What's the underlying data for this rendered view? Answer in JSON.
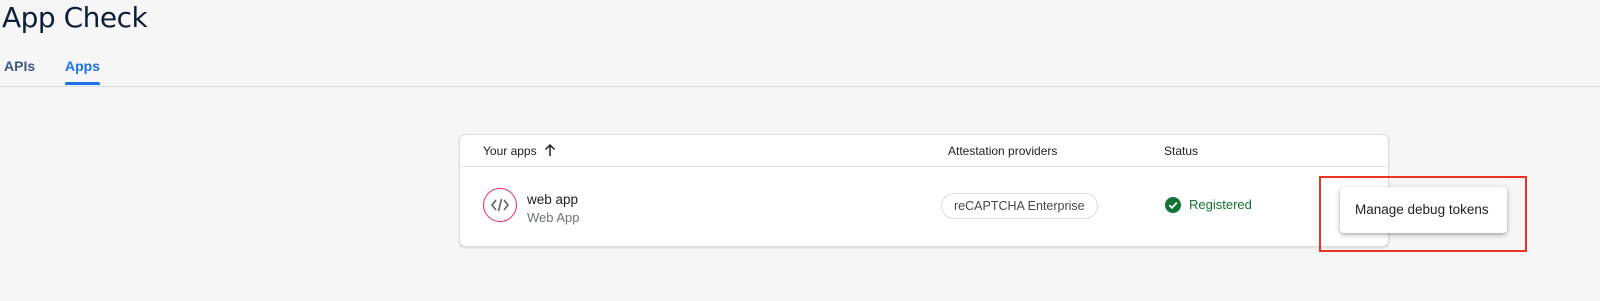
{
  "page": {
    "title": "App Check"
  },
  "tabs": [
    {
      "label": "APIs",
      "active": false
    },
    {
      "label": "Apps",
      "active": true
    }
  ],
  "table": {
    "columns": {
      "apps": "Your apps",
      "attestation": "Attestation providers",
      "status": "Status"
    },
    "sort_icon": "arrow-up-icon",
    "rows": [
      {
        "icon": "code-icon",
        "name": "web app",
        "platform": "Web App",
        "provider": "reCAPTCHA Enterprise",
        "status": "Registered",
        "status_icon": "check-circle-icon"
      }
    ]
  },
  "menu": {
    "items": [
      {
        "label": "Manage debug tokens"
      }
    ]
  },
  "colors": {
    "accent": "#1a73e8",
    "success": "#137333",
    "app_icon": "#e52d5e",
    "highlight": "#ea3323"
  }
}
